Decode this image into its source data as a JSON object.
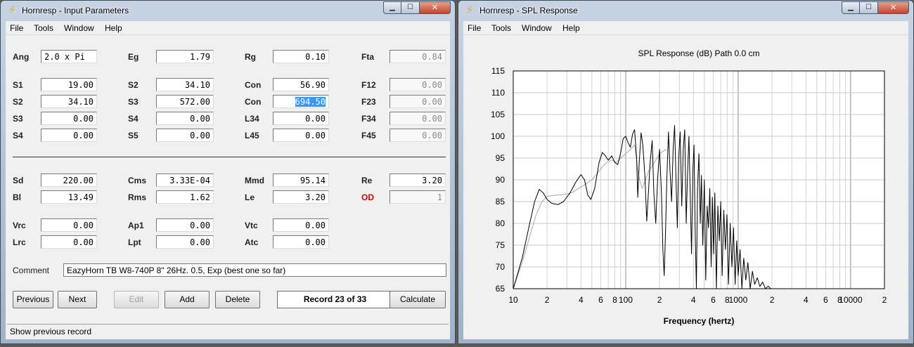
{
  "left_window": {
    "title": "Hornresp - Input Parameters",
    "menu": [
      "File",
      "Tools",
      "Window",
      "Help"
    ],
    "labels": {
      "ang": "Ang",
      "eg": "Eg",
      "rg": "Rg",
      "fta": "Fta",
      "s1": "S1",
      "s2a": "S2",
      "con1": "Con",
      "f12": "F12",
      "s2b": "S2",
      "s3a": "S3",
      "con2": "Con",
      "f23": "F23",
      "s3b": "S3",
      "s4a": "S4",
      "l34": "L34",
      "f34": "F34",
      "s4b": "S4",
      "s5": "S5",
      "l45": "L45",
      "f45": "F45",
      "sd": "Sd",
      "cms": "Cms",
      "mmd": "Mmd",
      "re": "Re",
      "bl": "Bl",
      "rms": "Rms",
      "le": "Le",
      "od": "OD",
      "vrc": "Vrc",
      "ap1": "Ap1",
      "vtc": "Vtc",
      "lrc": "Lrc",
      "lpt": "Lpt",
      "atc": "Atc",
      "comment": "Comment"
    },
    "values": {
      "ang": "2.0 x Pi",
      "eg": "1.79",
      "rg": "0.10",
      "fta": "0.84",
      "s1": "19.00",
      "s2a": "34.10",
      "con1": "56.90",
      "f12": "0.00",
      "s2b": "34.10",
      "s3a": "572.00",
      "con2": "694.50",
      "f23": "0.00",
      "s3b": "0.00",
      "s4a": "0.00",
      "l34": "0.00",
      "f34": "0.00",
      "s4b": "0.00",
      "s5": "0.00",
      "l45": "0.00",
      "f45": "0.00",
      "sd": "220.00",
      "cms": "3.33E-04",
      "mmd": "95.14",
      "re": "3.20",
      "bl": "13.49",
      "rms": "1.62",
      "le": "3.20",
      "od": "1",
      "vrc": "0.00",
      "ap1": "0.00",
      "vtc": "0.00",
      "lrc": "0.00",
      "lpt": "0.00",
      "atc": "0.00"
    },
    "comment": "EazyHorn TB W8-740P 8\" 26Hz. 0.5, Exp (best one so far)",
    "buttons": {
      "previous": "Previous",
      "next": "Next",
      "edit": "Edit",
      "add": "Add",
      "delete": "Delete",
      "calculate": "Calculate"
    },
    "record": "Record 23 of 33",
    "status": "Show previous record"
  },
  "right_window": {
    "title": "Hornresp - SPL Response",
    "menu": [
      "File",
      "Tools",
      "Window",
      "Help"
    ]
  },
  "colors": {
    "highlight": "#3399ff",
    "od_label": "#d00000",
    "title_icon": "#e8b400"
  },
  "chart_data": {
    "type": "line",
    "title": "SPL Response (dB)   Path 0.0 cm",
    "xlabel": "Frequency (hertz)",
    "ylabel": "",
    "x_scale": "log",
    "xlim": [
      10,
      20000
    ],
    "ylim": [
      65,
      115
    ],
    "y_ticks": [
      65,
      70,
      75,
      80,
      85,
      90,
      95,
      100,
      105,
      110,
      115
    ],
    "x_ticks": [
      {
        "value": 10,
        "label": "10"
      },
      {
        "value": 20,
        "label": "2"
      },
      {
        "value": 40,
        "label": "4"
      },
      {
        "value": 60,
        "label": "6"
      },
      {
        "value": 80,
        "label": "8"
      },
      {
        "value": 100,
        "label": "100"
      },
      {
        "value": 200,
        "label": "2"
      },
      {
        "value": 400,
        "label": "4"
      },
      {
        "value": 600,
        "label": "6"
      },
      {
        "value": 800,
        "label": "8"
      },
      {
        "value": 1000,
        "label": "1000"
      },
      {
        "value": 2000,
        "label": "2"
      },
      {
        "value": 4000,
        "label": "4"
      },
      {
        "value": 6000,
        "label": "6"
      },
      {
        "value": 8000,
        "label": "8"
      },
      {
        "value": 10000,
        "label": "10000"
      },
      {
        "value": 20000,
        "label": "2"
      }
    ],
    "grid": true,
    "series": [
      {
        "color": "#000000",
        "points": [
          [
            10,
            65
          ],
          [
            12,
            72
          ],
          [
            14,
            80
          ],
          [
            15.5,
            85
          ],
          [
            17,
            87.8
          ],
          [
            18.5,
            87
          ],
          [
            20,
            85.5
          ],
          [
            22,
            84.6
          ],
          [
            25,
            84.3
          ],
          [
            28,
            85
          ],
          [
            32,
            87
          ],
          [
            36,
            89.5
          ],
          [
            40,
            91.2
          ],
          [
            43,
            90
          ],
          [
            46,
            86.5
          ],
          [
            49,
            85.5
          ],
          [
            53,
            88
          ],
          [
            58,
            94
          ],
          [
            62,
            96.3
          ],
          [
            66,
            95.5
          ],
          [
            70,
            94.5
          ],
          [
            75,
            95.5
          ],
          [
            80,
            94
          ],
          [
            85,
            93.5
          ],
          [
            90,
            96
          ],
          [
            95,
            99.5
          ],
          [
            100,
            100
          ],
          [
            105,
            98.5
          ],
          [
            110,
            97.5
          ],
          [
            115,
            100.5
          ],
          [
            120,
            101.5
          ],
          [
            125,
            95
          ],
          [
            128,
            86
          ],
          [
            132,
            94
          ],
          [
            137,
            100.8
          ],
          [
            142,
            98
          ],
          [
            148,
            91
          ],
          [
            154,
            80.5
          ],
          [
            160,
            88
          ],
          [
            165,
            94
          ],
          [
            172,
            99
          ],
          [
            178,
            87
          ],
          [
            185,
            80
          ],
          [
            192,
            90
          ],
          [
            200,
            97
          ],
          [
            208,
            87
          ],
          [
            214,
            74
          ],
          [
            220,
            68
          ],
          [
            226,
            78
          ],
          [
            232,
            90
          ],
          [
            240,
            101
          ],
          [
            248,
            92
          ],
          [
            256,
            85
          ],
          [
            264,
            97
          ],
          [
            272,
            102.5
          ],
          [
            280,
            90
          ],
          [
            288,
            79
          ],
          [
            296,
            95
          ],
          [
            305,
            101
          ],
          [
            315,
            84
          ],
          [
            325,
            97
          ],
          [
            335,
            101.5
          ],
          [
            345,
            80
          ],
          [
            355,
            92
          ],
          [
            365,
            100
          ],
          [
            375,
            86
          ],
          [
            385,
            73
          ],
          [
            395,
            92
          ],
          [
            405,
            98
          ],
          [
            415,
            78
          ],
          [
            425,
            65
          ],
          [
            435,
            88
          ],
          [
            448,
            96
          ],
          [
            460,
            80
          ],
          [
            472,
            91
          ],
          [
            485,
            75
          ],
          [
            500,
            90
          ],
          [
            515,
            67
          ],
          [
            530,
            84
          ],
          [
            545,
            79
          ],
          [
            560,
            88
          ],
          [
            575,
            70
          ],
          [
            590,
            86
          ],
          [
            605,
            73
          ],
          [
            620,
            87
          ],
          [
            640,
            65
          ],
          [
            660,
            84
          ],
          [
            680,
            76
          ],
          [
            700,
            85
          ],
          [
            720,
            68
          ],
          [
            745,
            83
          ],
          [
            770,
            74
          ],
          [
            795,
            82
          ],
          [
            820,
            66
          ],
          [
            850,
            80
          ],
          [
            880,
            70
          ],
          [
            910,
            79
          ],
          [
            940,
            66
          ],
          [
            970,
            76
          ],
          [
            1000,
            68
          ],
          [
            1040,
            74
          ],
          [
            1080,
            65
          ],
          [
            1120,
            72
          ],
          [
            1170,
            67
          ],
          [
            1220,
            71
          ],
          [
            1280,
            65
          ],
          [
            1340,
            69
          ],
          [
            1400,
            66
          ],
          [
            1480,
            67.5
          ],
          [
            1560,
            65.5
          ],
          [
            1650,
            66.5
          ],
          [
            1750,
            65
          ],
          [
            1850,
            65.6
          ],
          [
            1950,
            65
          ]
        ]
      },
      {
        "color": "#a8a8a8",
        "points": [
          [
            10,
            65
          ],
          [
            12,
            71
          ],
          [
            14,
            77
          ],
          [
            16,
            82
          ],
          [
            18,
            85
          ],
          [
            20,
            86.2
          ],
          [
            24,
            86.5
          ],
          [
            28,
            86.6
          ],
          [
            33,
            87
          ],
          [
            38,
            88
          ],
          [
            44,
            89
          ],
          [
            50,
            90
          ],
          [
            56,
            91.5
          ],
          [
            62,
            93
          ],
          [
            68,
            94
          ],
          [
            75,
            94.5
          ],
          [
            82,
            94
          ],
          [
            90,
            95
          ],
          [
            100,
            96
          ],
          [
            110,
            97
          ],
          [
            120,
            98
          ],
          [
            130,
            91
          ],
          [
            140,
            88
          ],
          [
            150,
            90
          ],
          [
            160,
            92
          ],
          [
            180,
            94
          ],
          [
            200,
            96
          ],
          [
            230,
            97
          ]
        ]
      }
    ]
  }
}
